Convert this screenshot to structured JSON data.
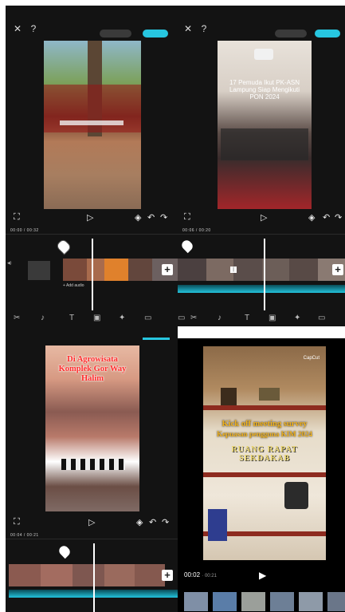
{
  "panel1": {
    "caption": "",
    "timecode": "00:00 / 00:32",
    "add_audio": "+ Add audio",
    "colors": {
      "accent": "#27c6e0",
      "waveform": "#23c3dc"
    }
  },
  "panel2": {
    "caption": "17 Pemuda Ikut PK-ASN Lampung Siap Mengikuti PON 2024",
    "timecode": "00:06 / 00:20"
  },
  "panel3": {
    "caption": "Di Agrowisata Komplek Gor Way Halim",
    "timecode": "00:04 / 00:21"
  },
  "panel4": {
    "brand": "CapCut",
    "caption_line1": "Kick off meeting survey",
    "caption_line2": "Kepuasan pengguna KIM 2024",
    "sign": "RUANG RAPAT SEKDAKAB",
    "time_current": "00:02",
    "time_total": "00:21"
  },
  "icons": {
    "close": "close-icon",
    "expand": "expand-icon",
    "play": "play-icon",
    "undo": "undo-icon",
    "redo": "redo-icon",
    "add": "plus-icon",
    "mute": "speaker-icon"
  }
}
